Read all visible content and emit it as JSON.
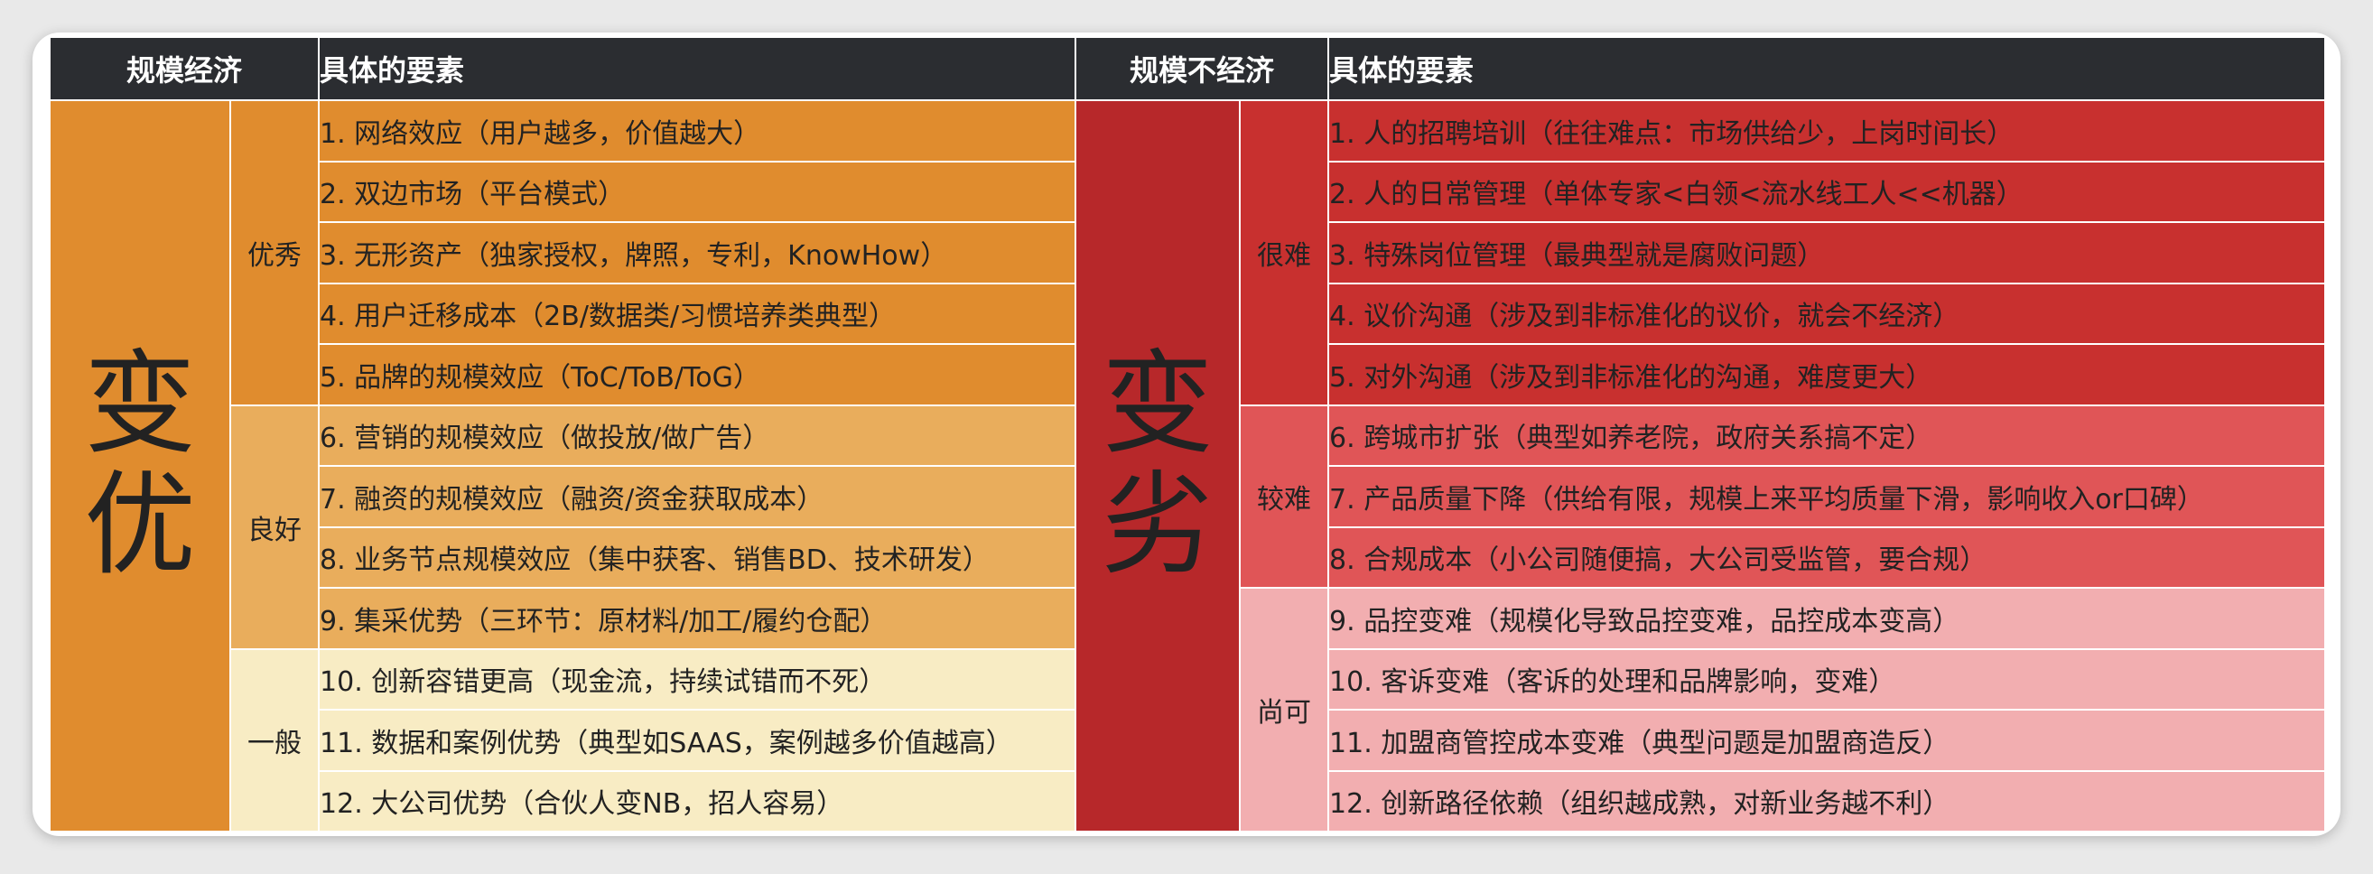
{
  "colors": {
    "header_bg": "#2b2d31",
    "left_big": "#e08c2e",
    "left_excellent": "#e08c2e",
    "left_good": "#e9ad5c",
    "left_normal": "#f8ecc4",
    "right_big": "#b7282a",
    "right_very_hard": "#c8302f",
    "right_hard": "#e05557",
    "right_ok": "#f2aeb0"
  },
  "left": {
    "header_title": "规模经济",
    "header_items": "具体的要素",
    "big_label_1": "变",
    "big_label_2": "优",
    "groups": [
      {
        "label": "优秀",
        "items": [
          "1. 网络效应（用户越多，价值越大）",
          "2. 双边市场（平台模式）",
          "3. 无形资产（独家授权，牌照，专利，KnowHow）",
          "4. 用户迁移成本（2B/数据类/习惯培养类典型）",
          "5. 品牌的规模效应（ToC/ToB/ToG）"
        ]
      },
      {
        "label": "良好",
        "items": [
          "6. 营销的规模效应（做投放/做广告）",
          "7. 融资的规模效应（融资/资金获取成本）",
          "8. 业务节点规模效应（集中获客、销售BD、技术研发）",
          "9. 集采优势（三环节：原材料/加工/履约仓配）"
        ]
      },
      {
        "label": "一般",
        "items": [
          "10. 创新容错更高（现金流，持续试错而不死）",
          "11. 数据和案例优势（典型如SAAS，案例越多价值越高）",
          "12. 大公司优势（合伙人变NB，招人容易）"
        ]
      }
    ]
  },
  "right": {
    "header_title": "规模不经济",
    "header_items": "具体的要素",
    "big_label_1": "变",
    "big_label_2": "劣",
    "groups": [
      {
        "label": "很难",
        "items": [
          "1. 人的招聘培训（往往难点：市场供给少，上岗时间长）",
          "2. 人的日常管理（单体专家<白领<流水线工人<<机器）",
          "3. 特殊岗位管理（最典型就是腐败问题）",
          "4. 议价沟通（涉及到非标准化的议价，就会不经济）",
          "5. 对外沟通（涉及到非标准化的沟通，难度更大）"
        ]
      },
      {
        "label": "较难",
        "items": [
          "6. 跨城市扩张（典型如养老院，政府关系搞不定）",
          "7. 产品质量下降（供给有限，规模上来平均质量下滑，影响收入or口碑）",
          "8. 合规成本（小公司随便搞，大公司受监管，要合规）"
        ]
      },
      {
        "label": "尚可",
        "items": [
          "9. 品控变难（规模化导致品控变难，品控成本变高）",
          "10. 客诉变难（客诉的处理和品牌影响，变难）",
          "11. 加盟商管控成本变难（典型问题是加盟商造反）",
          "12. 创新路径依赖（组织越成熟，对新业务越不利）"
        ]
      }
    ]
  }
}
